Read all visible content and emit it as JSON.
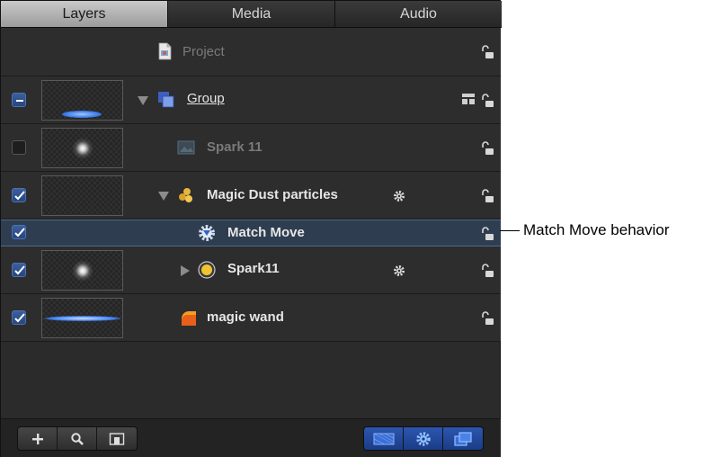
{
  "tabs": [
    {
      "label": "Layers",
      "active": true
    },
    {
      "label": "Media",
      "active": false
    },
    {
      "label": "Audio",
      "active": false
    }
  ],
  "layers": {
    "project": {
      "name": "Project",
      "icon": "project-document-icon"
    },
    "group": {
      "name": "Group",
      "icon": "group-stack-icon",
      "checkbox": "mixed",
      "expanded": true
    },
    "spark11_image": {
      "name": "Spark 11",
      "icon": "image-layer-icon",
      "checkbox": "off"
    },
    "magic_dust": {
      "name": "Magic Dust particles",
      "icon": "particle-emitter-icon",
      "checkbox": "on",
      "expanded": true,
      "has_behavior": true
    },
    "match_move": {
      "name": "Match Move",
      "icon": "behavior-gear-icon",
      "checkbox": "on",
      "selected": true
    },
    "spark11_cell": {
      "name": "Spark11",
      "icon": "particle-cell-icon",
      "checkbox": "on",
      "expanded": false,
      "has_behavior": true
    },
    "magic_wand": {
      "name": "magic wand",
      "icon": "shape-layer-icon",
      "checkbox": "on"
    }
  },
  "footer": {
    "left_buttons": [
      "add-icon",
      "search-icon",
      "layer-view-icon"
    ],
    "right_buttons": [
      "show-masks-icon",
      "show-behaviors-icon",
      "show-filters-icon"
    ]
  },
  "callout": {
    "text": "Match Move behavior"
  },
  "colors": {
    "accent": "#3a64b8",
    "panel": "#2b2b2b",
    "selected_row": "#2f3d50"
  }
}
